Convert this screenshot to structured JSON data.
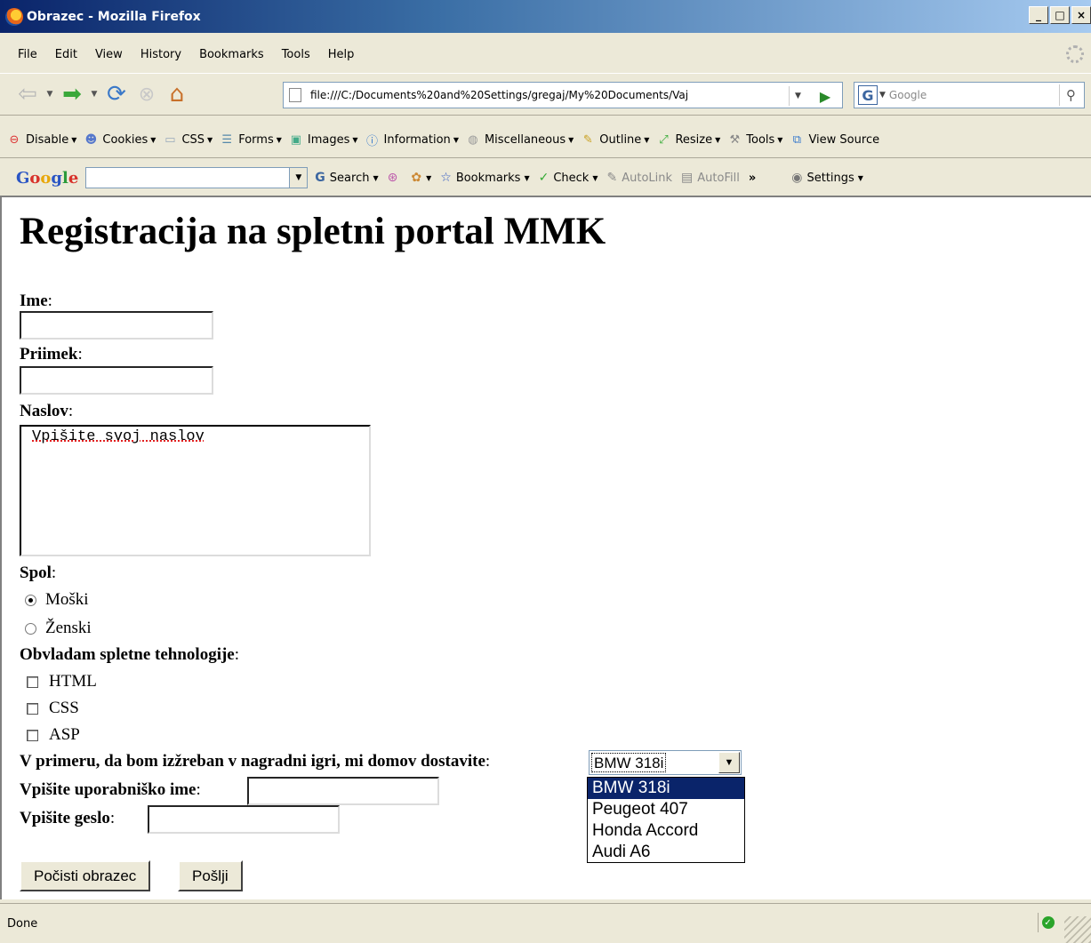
{
  "window": {
    "title": "Obrazec - Mozilla Firefox",
    "min": "_",
    "max": "□",
    "close": "×"
  },
  "menu": [
    "File",
    "Edit",
    "View",
    "History",
    "Bookmarks",
    "Tools",
    "Help"
  ],
  "nav": {
    "url": "file:///C:/Documents%20and%20Settings/gregaj/My%20Documents/Vaj",
    "search_placeholder": "Google"
  },
  "webdev": [
    {
      "label": "Disable",
      "icon": "disable-icon"
    },
    {
      "label": "Cookies",
      "icon": "cookies-icon"
    },
    {
      "label": "CSS",
      "icon": "css-icon"
    },
    {
      "label": "Forms",
      "icon": "forms-icon"
    },
    {
      "label": "Images",
      "icon": "images-icon"
    },
    {
      "label": "Information",
      "icon": "information-icon"
    },
    {
      "label": "Miscellaneous",
      "icon": "miscellaneous-icon"
    },
    {
      "label": "Outline",
      "icon": "outline-icon"
    },
    {
      "label": "Resize",
      "icon": "resize-icon"
    },
    {
      "label": "Tools",
      "icon": "tools-icon"
    },
    {
      "label": "View Source",
      "icon": "view-source-icon"
    }
  ],
  "google_bar": {
    "search": "Search",
    "bookmarks": "Bookmarks",
    "check": "Check",
    "autolink": "AutoLink",
    "autofill": "AutoFill",
    "more": "»",
    "settings": "Settings"
  },
  "page": {
    "heading": "Registracija na spletni portal MMK",
    "ime": "Ime",
    "priimek": "Priimek",
    "naslov": "Naslov",
    "naslov_value": "Vpišite svoj naslov",
    "spol": "Spol",
    "spol_options": [
      "Moški",
      "Ženski"
    ],
    "spol_selected": "Moški",
    "tech_label": "Obvladam spletne tehnologije",
    "tech_options": [
      "HTML",
      "CSS",
      "ASP"
    ],
    "prize_label": "V primeru, da bom izžreban v nagradni igri, mi domov dostavite",
    "prize_selected": "BMW 318i",
    "prize_options": [
      "BMW 318i",
      "Peugeot 407",
      "Honda Accord",
      "Audi A6"
    ],
    "username_label": "Vpišite uporabniško ime",
    "password_label": "Vpišite geslo",
    "reset_button": "Počisti obrazec",
    "submit_button": "Pošlji",
    "colon": ":"
  },
  "status": {
    "text": "Done"
  }
}
